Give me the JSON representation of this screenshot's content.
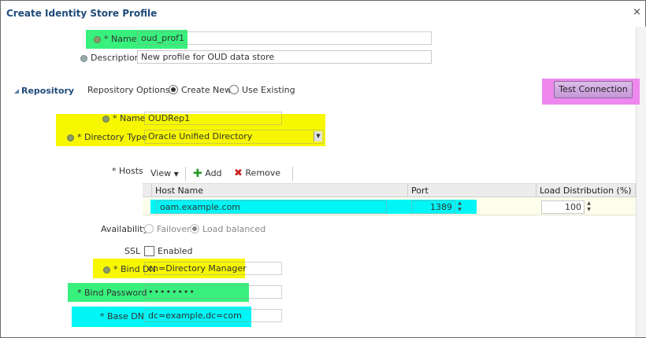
{
  "dialog": {
    "title": "Create Identity Store Profile",
    "close_symbol": "×"
  },
  "profile": {
    "name_label": "* Name",
    "name_value": "oud_prof1",
    "description_label": "Description",
    "description_value": "New profile for OUD data store"
  },
  "repository": {
    "section_label": "Repository",
    "options_label": "Repository Options",
    "option_create": "Create New",
    "option_existing": "Use Existing",
    "selected_option": "Create New",
    "test_button": "Test Connection",
    "name_label": "* Name",
    "name_value": "OUDRep1",
    "dirtype_label": "* Directory Type",
    "dirtype_value": "Oracle Unified Directory",
    "hosts_label": "* Hosts",
    "toolbar": {
      "view": "View",
      "add": "Add",
      "remove": "Remove"
    },
    "columns": [
      "Host Name",
      "Port",
      "Load Distribution (%)"
    ],
    "rows": [
      {
        "host": "oam.example.com",
        "port": "1389",
        "load": "100"
      }
    ],
    "availability_label": "Availability",
    "availability_failover": "Failover",
    "availability_balanced": "Load balanced",
    "ssl_label": "SSL",
    "ssl_enabled_label": "Enabled",
    "binddn_label": "* Bind DN",
    "binddn_value": "cn=Directory Manager",
    "bindpw_label": "* Bind Password",
    "bindpw_value": "••••••••",
    "basedn_label": "* Base DN",
    "basedn_value": "dc=example,dc=com"
  },
  "colors": {
    "green_highlight": "#38f07c",
    "yellow_highlight": "#f7f700",
    "cyan_highlight": "#00f6f6",
    "pink_highlight": "#ee88ee",
    "title_color": "#1f4b7a"
  },
  "icons": [
    "close-icon",
    "help-dot-icon",
    "section-collapse-icon",
    "dropdown-arrow-icon",
    "add-icon",
    "remove-icon",
    "spinner-icon"
  ]
}
